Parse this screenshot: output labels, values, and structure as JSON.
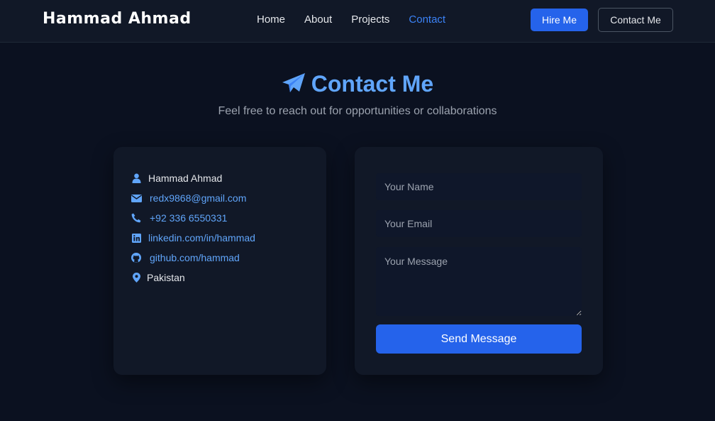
{
  "brand": "Hammad Ahmad",
  "nav": {
    "links": [
      {
        "label": "Home"
      },
      {
        "label": "About"
      },
      {
        "label": "Projects"
      },
      {
        "label": "Contact",
        "active": true
      }
    ],
    "hire_label": "Hire Me",
    "contact_label": "Contact Me"
  },
  "section": {
    "icon": "paper-plane-icon",
    "title": "Contact Me",
    "subtitle": "Feel free to reach out for opportunities or collaborations"
  },
  "info": {
    "name": "Hammad Ahmad",
    "email": "redx9868@gmail.com",
    "phone": "+92 336 6550331",
    "linkedin": "linkedin.com/in/hammad",
    "github": "github.com/hammad",
    "location": "Pakistan"
  },
  "form": {
    "name_placeholder": "Your Name",
    "email_placeholder": "Your Email",
    "message_placeholder": "Your Message",
    "submit_label": "Send Message"
  },
  "colors": {
    "background": "#0b1120",
    "card": "#111827",
    "accent": "#2563eb",
    "link": "#60a5fa"
  }
}
